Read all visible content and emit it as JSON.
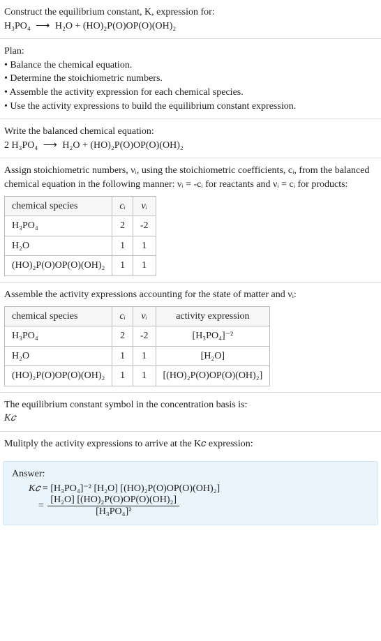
{
  "prompt": {
    "line1": "Construct the equilibrium constant, K, expression for:",
    "eq_left": "H₃PO₄",
    "eq_arrow": "⟶",
    "eq_right": "H₂O + (HO)₂P(O)OP(O)(OH)₂"
  },
  "plan": {
    "title": "Plan:",
    "b1": "• Balance the chemical equation.",
    "b2": "• Determine the stoichiometric numbers.",
    "b3": "• Assemble the activity expression for each chemical species.",
    "b4": "• Use the activity expressions to build the equilibrium constant expression."
  },
  "balanced": {
    "title": "Write the balanced chemical equation:",
    "eq_left": "2 H₃PO₄",
    "eq_arrow": "⟶",
    "eq_right": "H₂O + (HO)₂P(O)OP(O)(OH)₂"
  },
  "assign": {
    "text": "Assign stoichiometric numbers, νᵢ, using the stoichiometric coefficients, cᵢ, from the balanced chemical equation in the following manner: νᵢ = -cᵢ for reactants and νᵢ = cᵢ for products:",
    "headers": {
      "species": "chemical species",
      "ci": "cᵢ",
      "vi": "νᵢ"
    },
    "rows": [
      {
        "species": "H₃PO₄",
        "ci": "2",
        "vi": "-2"
      },
      {
        "species": "H₂O",
        "ci": "1",
        "vi": "1"
      },
      {
        "species": "(HO)₂P(O)OP(O)(OH)₂",
        "ci": "1",
        "vi": "1"
      }
    ]
  },
  "activity": {
    "title": "Assemble the activity expressions accounting for the state of matter and νᵢ:",
    "headers": {
      "species": "chemical species",
      "ci": "cᵢ",
      "vi": "νᵢ",
      "expr": "activity expression"
    },
    "rows": [
      {
        "species": "H₃PO₄",
        "ci": "2",
        "vi": "-2",
        "expr": "[H₃PO₄]⁻²"
      },
      {
        "species": "H₂O",
        "ci": "1",
        "vi": "1",
        "expr": "[H₂O]"
      },
      {
        "species": "(HO)₂P(O)OP(O)(OH)₂",
        "ci": "1",
        "vi": "1",
        "expr": "[(HO)₂P(O)OP(O)(OH)₂]"
      }
    ]
  },
  "symbol": {
    "line": "The equilibrium constant symbol in the concentration basis is:",
    "kc": "K𝑐"
  },
  "multiply": {
    "line": "Mulitply the activity expressions to arrive at the K𝑐 expression:"
  },
  "answer": {
    "label": "Answer:",
    "kc": "K𝑐",
    "expr1": "= [H₃PO₄]⁻² [H₂O] [(HO)₂P(O)OP(O)(OH)₂]",
    "eq2": "=",
    "num": "[H₂O] [(HO)₂P(O)OP(O)(OH)₂]",
    "den": "[H₃PO₄]²"
  }
}
